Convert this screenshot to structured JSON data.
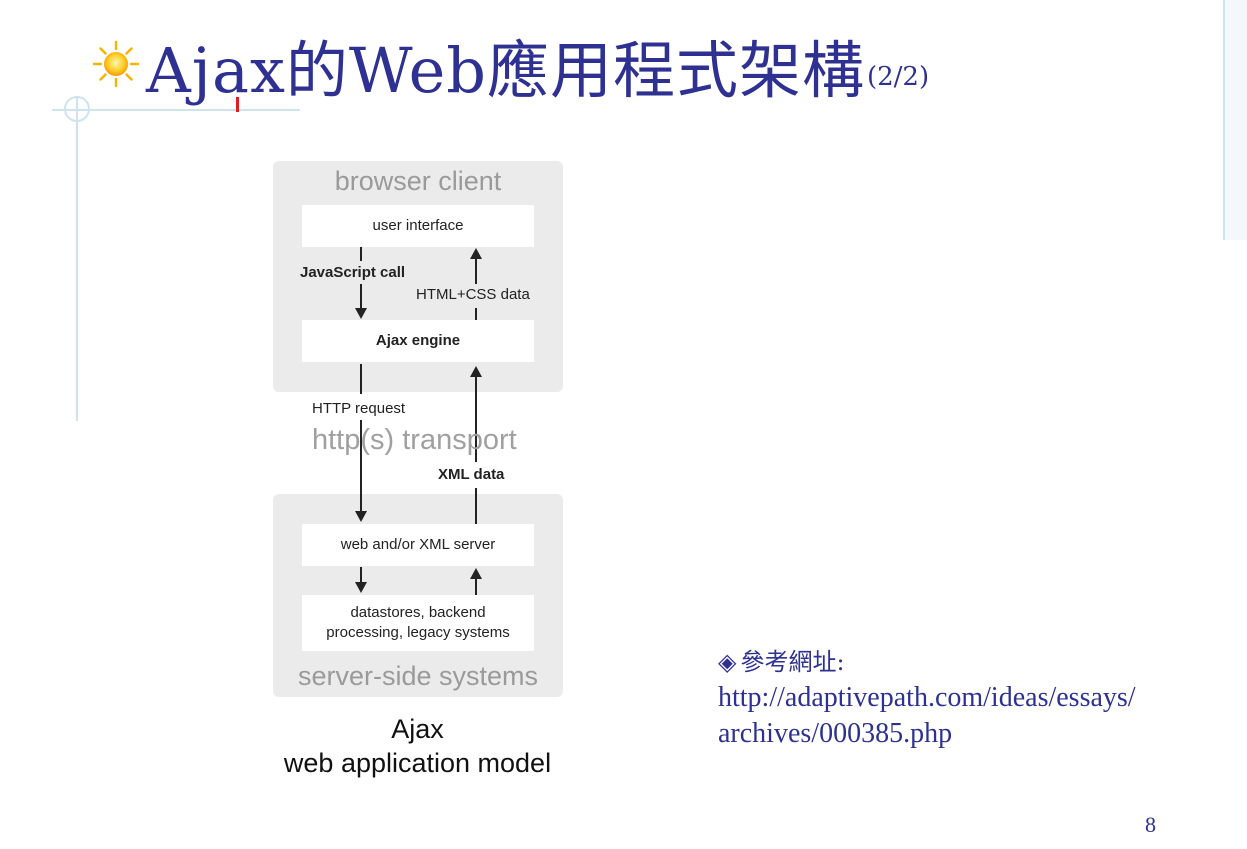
{
  "slide": {
    "title": "Ajax的Web應用程式架構",
    "title_suffix": "(2/2)",
    "page_number": "8"
  },
  "diagram": {
    "browser_panel_title": "browser client",
    "user_interface": "user interface",
    "javascript_call": "JavaScript call",
    "html_css_data": "HTML+CSS data",
    "ajax_engine": "Ajax engine",
    "http_request": "HTTP request",
    "transport": "http(s) transport",
    "xml_data": "XML data",
    "web_server": "web and/or XML server",
    "datastores_line1": "datastores, backend",
    "datastores_line2": "processing, legacy systems",
    "server_panel_title": "server-side systems",
    "caption_line1": "Ajax",
    "caption_line2": "web application model"
  },
  "reference": {
    "bullet_icon": "diamond-bullet-icon",
    "heading": "參考網址:",
    "url_line1": "http://adaptivepath.com/ideas/essays/",
    "url_line2": "archives/000385.php"
  },
  "colors": {
    "title": "#2e3192",
    "panel": "#ebebeb",
    "panel_title": "#9a9a9a",
    "cursor": "#e31b23"
  }
}
